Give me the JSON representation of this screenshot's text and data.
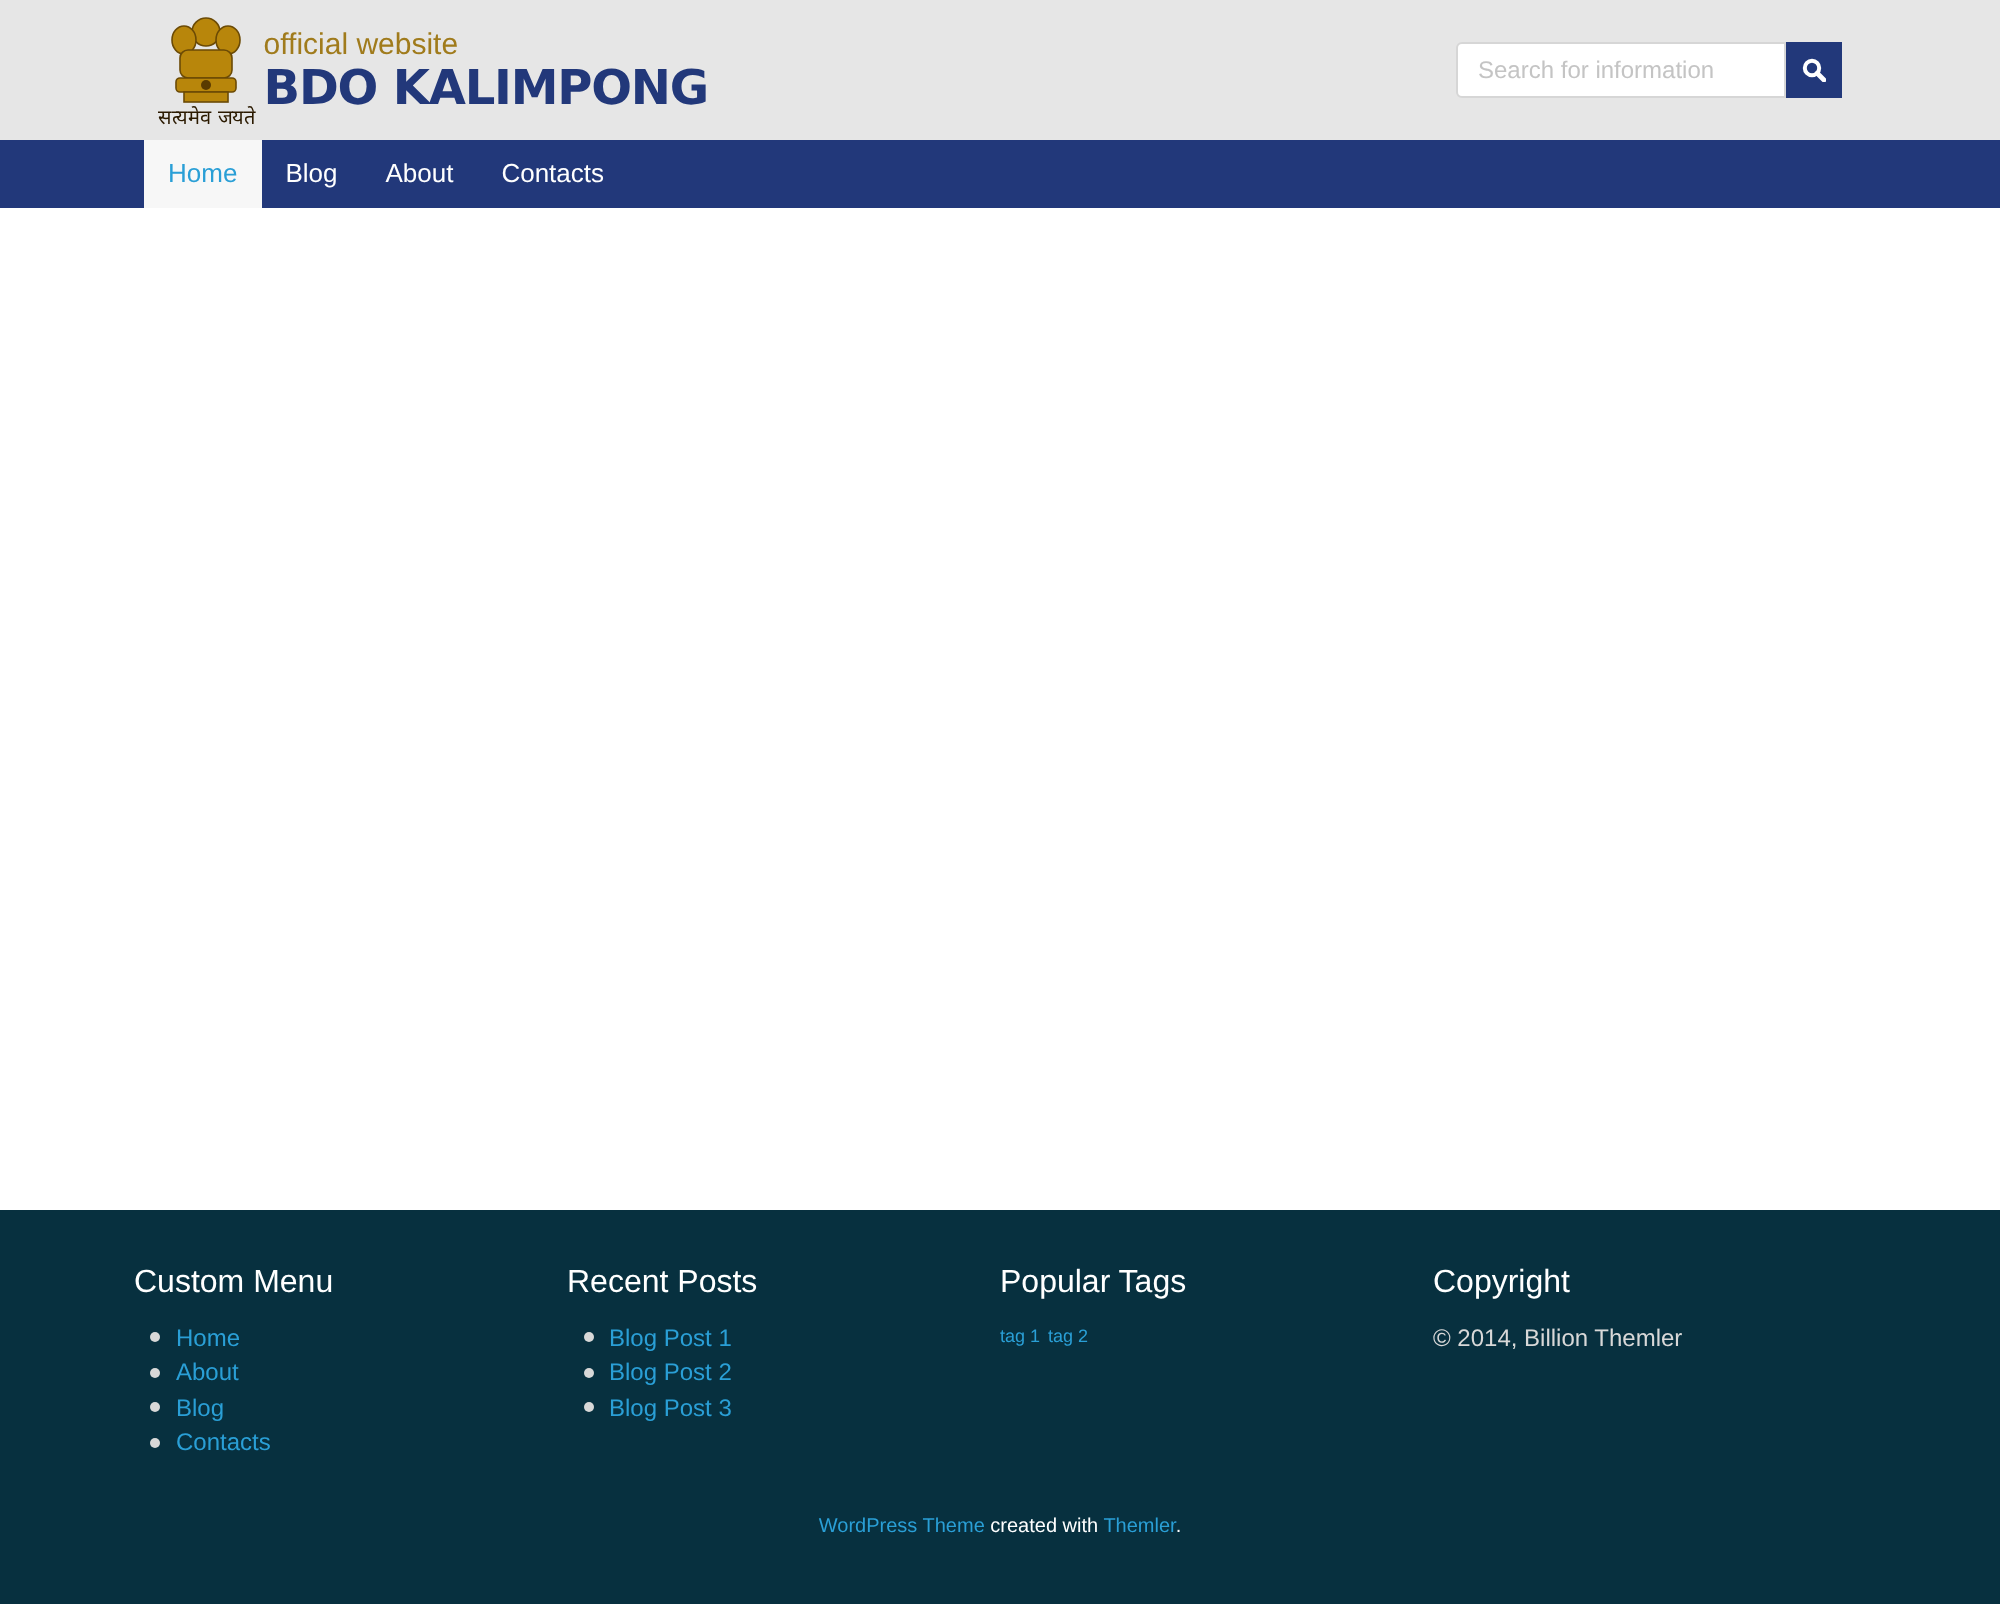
{
  "header": {
    "logo": {
      "tagline": "official website",
      "title": "BDO KALIMPONG",
      "motto": "सत्यमेव जयते"
    },
    "search": {
      "placeholder": "Search for information"
    }
  },
  "nav": [
    {
      "label": "Home",
      "selected": true
    },
    {
      "label": "Blog",
      "selected": false
    },
    {
      "label": "About",
      "selected": false
    },
    {
      "label": "Contacts",
      "selected": false
    }
  ],
  "footer": {
    "columns": [
      {
        "title": "Custom Menu",
        "kind": "list",
        "items": [
          "Home",
          "About",
          "Blog",
          "Contacts"
        ]
      },
      {
        "title": "Recent Posts",
        "kind": "list",
        "items": [
          "Blog Post 1",
          "Blog Post 2",
          "Blog Post 3"
        ]
      },
      {
        "title": "Popular Tags",
        "kind": "tags",
        "items": [
          "tag 1",
          "tag 2"
        ]
      },
      {
        "title": "Copyright",
        "kind": "text",
        "text": "© 2014, Billion Themler"
      }
    ],
    "credit": [
      {
        "kind": "link",
        "text": "WordPress Theme"
      },
      {
        "kind": "text",
        "text": " created with "
      },
      {
        "kind": "link",
        "text": "Themler"
      },
      {
        "kind": "text",
        "text": "."
      }
    ]
  }
}
